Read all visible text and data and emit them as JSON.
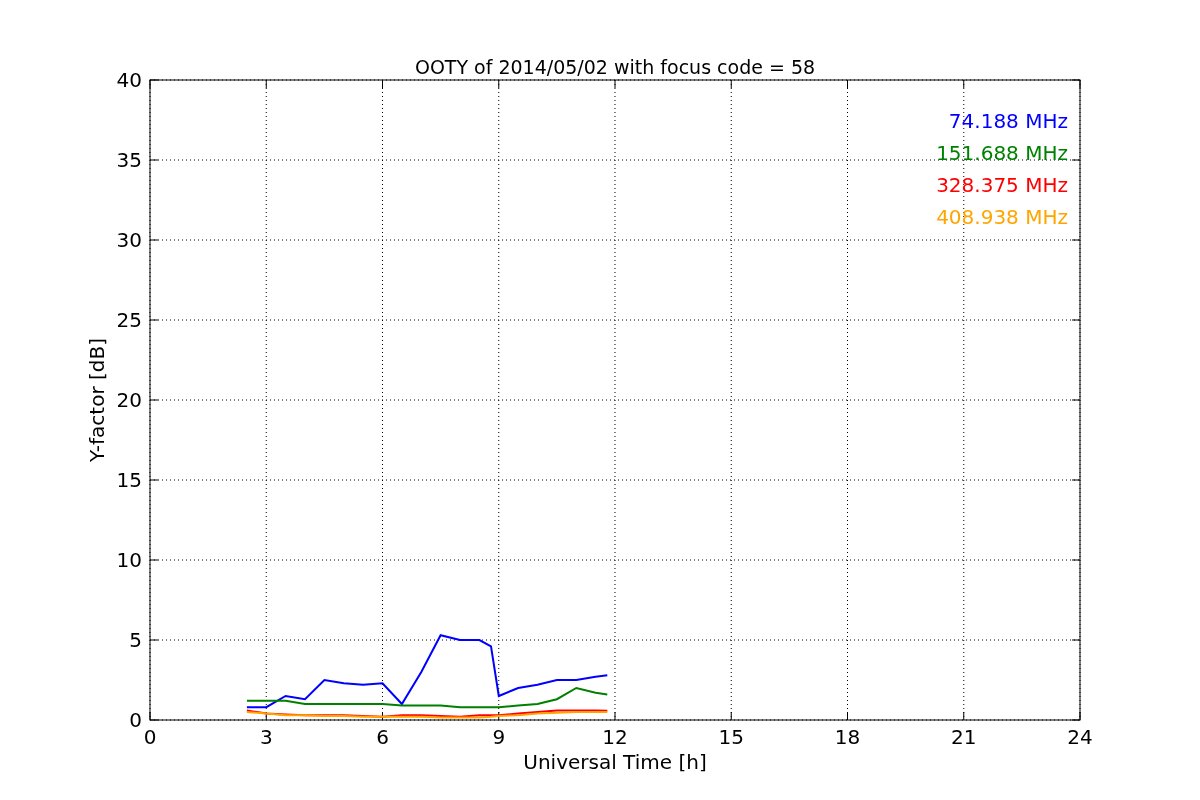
{
  "chart_data": {
    "type": "line",
    "title": "OOTY of 2014/05/02 with focus code = 58",
    "xlabel": "Universal Time [h]",
    "ylabel": "Y-factor [dB]",
    "x": [
      2.5,
      3,
      3.5,
      4,
      4.5,
      5,
      5.5,
      6,
      6.5,
      7,
      7.5,
      8,
      8.5,
      8.8,
      9,
      9.5,
      10,
      10.5,
      11,
      11.5,
      11.8
    ],
    "series": [
      {
        "name": "74.188 MHz",
        "color": "#0000ff",
        "values": [
          0.8,
          0.8,
          1.5,
          1.3,
          2.5,
          2.3,
          2.2,
          2.3,
          1.0,
          3.0,
          5.3,
          5.0,
          5.0,
          4.6,
          1.5,
          2.0,
          2.2,
          2.5,
          2.5,
          2.7,
          2.8
        ]
      },
      {
        "name": "151.688 MHz",
        "color": "#008000",
        "values": [
          1.2,
          1.2,
          1.2,
          1.0,
          1.0,
          1.0,
          1.0,
          1.0,
          0.9,
          0.9,
          0.9,
          0.8,
          0.8,
          0.8,
          0.8,
          0.9,
          1.0,
          1.3,
          2.0,
          1.7,
          1.6
        ]
      },
      {
        "name": "328.375 MHz",
        "color": "#ff0000",
        "values": [
          0.6,
          0.4,
          0.35,
          0.3,
          0.3,
          0.3,
          0.25,
          0.2,
          0.3,
          0.3,
          0.25,
          0.2,
          0.3,
          0.3,
          0.3,
          0.4,
          0.5,
          0.6,
          0.6,
          0.6,
          0.58
        ]
      },
      {
        "name": "408.938 MHz",
        "color": "#ffa500",
        "values": [
          0.5,
          0.4,
          0.3,
          0.3,
          0.25,
          0.25,
          0.2,
          0.2,
          0.2,
          0.2,
          0.15,
          0.15,
          0.15,
          0.2,
          0.25,
          0.3,
          0.4,
          0.45,
          0.5,
          0.5,
          0.5
        ]
      }
    ],
    "grid": true,
    "xlim": [
      0,
      24
    ],
    "ylim": [
      0,
      40
    ],
    "xticks": [
      0,
      3,
      6,
      9,
      12,
      15,
      18,
      21,
      24
    ],
    "yticks": [
      0,
      5,
      10,
      15,
      20,
      25,
      30,
      35,
      40
    ]
  }
}
